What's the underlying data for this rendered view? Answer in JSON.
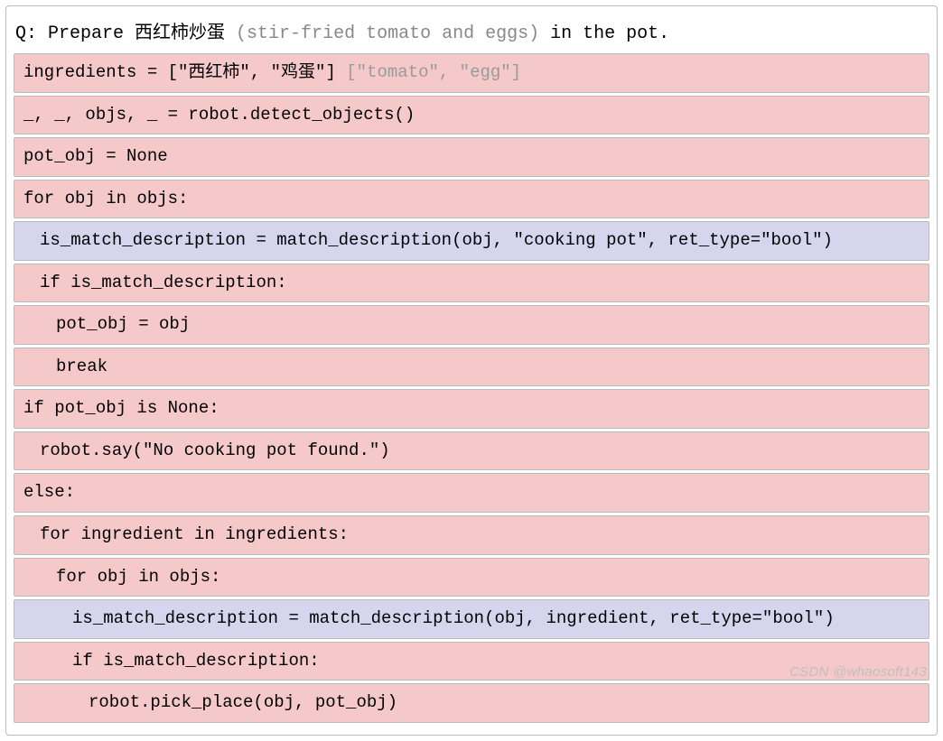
{
  "question": {
    "prefix": "Q: ",
    "part1": "Prepare 西红柿炒蛋 ",
    "paren": "(stir-fried tomato and eggs)",
    "part2": " in the pot."
  },
  "code": [
    {
      "bg": "pink",
      "indent": 0,
      "text": "ingredients = [\"西红柿\", \"鸡蛋\"] ",
      "gray": "[\"tomato\", \"egg\"]"
    },
    {
      "bg": "pink",
      "indent": 0,
      "text": "_, _, objs, _ = robot.detect_objects()"
    },
    {
      "bg": "pink",
      "indent": 0,
      "text": "pot_obj = None"
    },
    {
      "bg": "pink",
      "indent": 0,
      "text": "for obj in objs:"
    },
    {
      "bg": "purple",
      "indent": 1,
      "text": "is_match_description = match_description(obj, \"cooking pot\", ret_type=\"bool\")"
    },
    {
      "bg": "pink",
      "indent": 1,
      "text": "if is_match_description:"
    },
    {
      "bg": "pink",
      "indent": 2,
      "text": "pot_obj = obj"
    },
    {
      "bg": "pink",
      "indent": 2,
      "text": "break"
    },
    {
      "bg": "pink",
      "indent": 0,
      "text": "if pot_obj is None:"
    },
    {
      "bg": "pink",
      "indent": 1,
      "text": "robot.say(\"No cooking pot found.\")"
    },
    {
      "bg": "pink",
      "indent": 0,
      "text": "else:"
    },
    {
      "bg": "pink",
      "indent": 1,
      "text": "for ingredient in ingredients:"
    },
    {
      "bg": "pink",
      "indent": 2,
      "text": "for obj in objs:"
    },
    {
      "bg": "purple",
      "indent": 3,
      "text": "is_match_description = match_description(obj, ingredient, ret_type=\"bool\")"
    },
    {
      "bg": "pink",
      "indent": 3,
      "text": "if is_match_description:"
    },
    {
      "bg": "pink",
      "indent": 4,
      "text": "robot.pick_place(obj, pot_obj)"
    }
  ],
  "watermark": "CSDN @whaosoft143"
}
